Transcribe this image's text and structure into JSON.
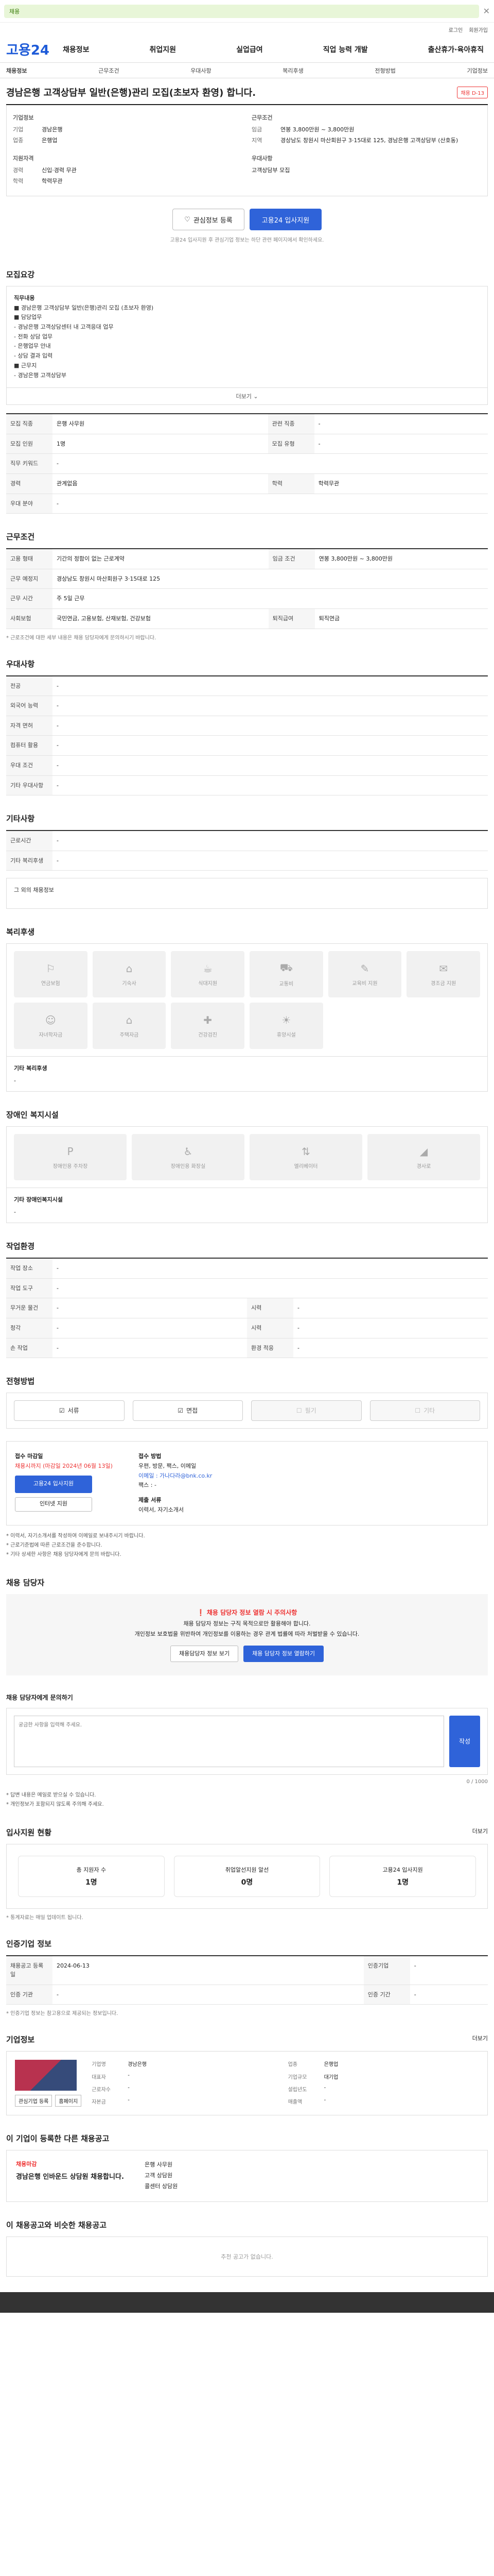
{
  "banner": {
    "text": "채용"
  },
  "util": [
    "로그인",
    "회원가입"
  ],
  "gnb": {
    "logo": "고용24",
    "menus": [
      "채용정보",
      "취업지원",
      "실업급여",
      "직업 능력 개발",
      "출산휴가·육아휴직"
    ]
  },
  "lnb": [
    "채용정보",
    "근무조건",
    "우대사항",
    "복리후생",
    "전형방법",
    "기업정보"
  ],
  "job": {
    "title": "경남은행 고객상담부 일반(은행)관리 모집(초보자 환영) 합니다.",
    "badge": "채용 D-13",
    "company_label": "기업정보",
    "company": [
      [
        "기업",
        "경남은행"
      ],
      [
        "업종",
        "은행업"
      ]
    ],
    "cond_label": "근무조건",
    "cond": [
      [
        "임금",
        "연봉 3,800만원 ~ 3,800만원"
      ],
      [
        "지역",
        "경상남도 창원시 마산회원구 3·15대로 125, 경남은행 고객상담부 (산호동)"
      ]
    ],
    "qual_label": "지원자격",
    "qual": [
      [
        "경력",
        "신입·경력 무관"
      ],
      [
        "학력",
        "학력무관"
      ]
    ],
    "extra_label": "우대사항",
    "apply_note": "고객상담부 모집"
  },
  "actions": {
    "scrap": "관심정보 등록",
    "apply": "고용24 입사지원",
    "note": "고용24 입사지원 후 관심기업 정보는 하단 관련 페이지에서 확인하세요."
  },
  "recruit": {
    "title": "모집요강",
    "box": [
      "직무내용",
      "■ 경남은행 고객상담부 일반(은행)관리 모집 (초보자 환영)",
      "",
      "■ 담당업무",
      " - 경남은행 고객상담센터 내 고객응대 업무",
      " - 전화 상담 업무",
      " - 은행업무 안내",
      " - 상담 결과 입력",
      "",
      "■ 근무지",
      " - 경남은행 고객상담부"
    ],
    "more": "더보기",
    "rows": [
      [
        "모집 직종",
        "은행 사무원",
        "관련 직종",
        "-"
      ],
      [
        "모집 인원",
        "1명",
        "모집 유형",
        "-"
      ],
      [
        "직무 키워드",
        "-",
        "",
        ""
      ],
      [
        "경력",
        "관계없음",
        "학력",
        "학력무관"
      ],
      [
        "우대 분야",
        "-",
        "",
        ""
      ]
    ]
  },
  "work": {
    "title": "근무조건",
    "rows": [
      [
        "고용 형태",
        "기간의 정함이 없는 근로계약",
        "임금 조건",
        "연봉 3,800만원 ~ 3,800만원"
      ],
      [
        "근무 예정지",
        "경상남도 창원시 마산회원구 3·15대로 125",
        "",
        ""
      ],
      [
        "근무 시간",
        "주 5일 근무",
        "",
        ""
      ],
      [
        "사회보험",
        "국민연금, 고용보험, 산재보험, 건강보험",
        "퇴직급여",
        "퇴직연금"
      ]
    ],
    "note": "* 근로조건에 대한 세부 내용은 채용 담당자에게 문의하시기 바랍니다."
  },
  "pref": {
    "title": "우대사항",
    "rows": [
      [
        "전공",
        "-"
      ],
      [
        "외국어 능력",
        "-"
      ],
      [
        "자격 면허",
        "-"
      ],
      [
        "컴퓨터 활용",
        "-"
      ],
      [
        "우대 조건",
        "-"
      ],
      [
        "기타 우대사항",
        "-"
      ]
    ]
  },
  "other": {
    "title": "기타사항",
    "rows": [
      [
        "근로시간",
        "-"
      ],
      [
        "기타 복리후생",
        "-"
      ]
    ],
    "etc": "그 외의 채용정보"
  },
  "welfare": {
    "title": "복리후생",
    "items": [
      "연금보험",
      "기숙사",
      "식대지원",
      "교통비",
      "교육비 지원",
      "경조금 지원",
      "자녀학자금",
      "주택자금",
      "건강검진",
      "휴양시설"
    ],
    "extra": "기타 복리후생"
  },
  "disabled": {
    "title": "장애인 복지시설",
    "items": [
      "장애인용 주차장",
      "장애인용 화장실",
      "엘리베이터",
      "경사로"
    ],
    "extra": "기타 장애인복지시설"
  },
  "work_env": {
    "title": "작업환경",
    "rows": [
      [
        "작업 장소",
        "-",
        "",
        ""
      ],
      [
        "작업 도구",
        "-",
        "",
        ""
      ],
      [
        "무거운 물건",
        "-",
        "시력",
        "-"
      ],
      [
        "청각",
        "-",
        "시력",
        "-"
      ],
      [
        "손 작업",
        "-",
        "환경 적응",
        "-"
      ]
    ]
  },
  "method": {
    "title": "전형방법",
    "items": [
      "서류",
      "면접",
      "필기",
      "기타"
    ]
  },
  "apply": {
    "deadline_label": "접수 마감일",
    "deadline": "채용시까지 (마감일 2024년 06월 13일)",
    "btn": "고용24 입사지원",
    "btn2": "인터넷 지원",
    "method_label": "접수 방법",
    "methods": [
      "우편, 방문, 팩스, 이메일",
      "이메일 : 가나다라@bnk.co.kr",
      "팩스 : -"
    ],
    "doc_label": "제출 서류",
    "docs": [
      "이력서, 자기소개서"
    ],
    "bullets": [
      "* 이력서, 자기소개서를 작성하여 이메일로 보내주시기 바랍니다.",
      "* 근로기준법에 따른 근로조건을 준수합니다.",
      "* 기타 상세한 사항은 채용 담당자에게 문의 바랍니다."
    ]
  },
  "contact": {
    "title": "채용 담당자",
    "warn": "채용 담당자 정보 열람 시 주의사항",
    "lines": [
      "채용 담당자 정보는 구직 목적으로만 활용해야 합니다.",
      "개인정보 보호법을 위반하여 개인정보를 이용하는 경우 관계 법률에 따라 처벌받을 수 있습니다."
    ],
    "btn1": "채용담당자 정보 보기",
    "btn2": "채용 담당자 정보 열람하기"
  },
  "ask": {
    "title": "채용 담당자에게 문의하기",
    "placeholder": "궁금한 사항을 입력해 주세요.",
    "send": "작성",
    "counter": "0 / 1000",
    "notes": [
      "* 답변 내용은 메일로 받으실 수 있습니다.",
      "* 개인정보가 포함되지 않도록 주의해 주세요."
    ]
  },
  "stats": {
    "title": "입사지원 현황",
    "more": "더보기",
    "items": [
      [
        "총 지원자 수",
        "1명"
      ],
      [
        "취업알선지원 알선",
        "0명"
      ],
      [
        "고용24 입사지원",
        "1명"
      ]
    ],
    "note": "* 통계자료는 매일 업데이트 됩니다."
  },
  "info": {
    "title": "인증기업 정보",
    "rows": [
      [
        "채용공고 등록일",
        "2024-06-13",
        "인증기업",
        "-"
      ],
      [
        "인증 기관",
        "-",
        "인증 기간",
        "-"
      ]
    ],
    "note": "* 인증기업 정보는 참고용으로 제공되는 정보입니다."
  },
  "company": {
    "title": "기업정보",
    "more": "더보기",
    "rows": [
      [
        "기업명",
        "경남은행",
        "업종",
        "은행업"
      ],
      [
        "대표자",
        "-",
        "기업규모",
        "대기업"
      ],
      [
        "근로자수",
        "-",
        "설립년도",
        "-"
      ],
      [
        "자본금",
        "-",
        "매출액",
        "-"
      ]
    ],
    "btns": [
      "관심기업 등록",
      "홈페이지"
    ]
  },
  "other_jobs": {
    "title": "이 기업이 등록한 다른 채용공고",
    "tag": "채용마감",
    "name": "경남은행 인바운드 상담원 채용합니다.",
    "list": [
      "은행 사무원",
      "고객 상담원",
      "콜센터 상담원"
    ]
  },
  "recommend": {
    "title": "이 채용공고와 비슷한 채용공고",
    "empty": "추천 공고가 없습니다."
  }
}
